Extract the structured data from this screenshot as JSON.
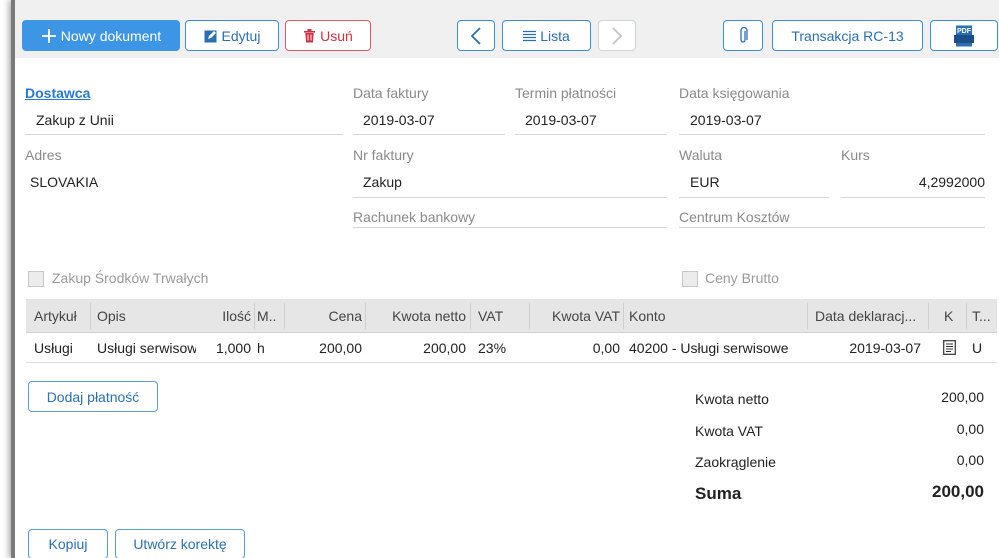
{
  "toolbar": {
    "new_doc": "Nowy dokument",
    "edit": "Edytuj",
    "delete": "Usuń",
    "list": "Lista",
    "transaction": "Transakcja RC-13",
    "pdf_label": "PDF"
  },
  "header": {
    "supplier_label": "Dostawca",
    "supplier_value": "Zakup z Unii",
    "invoice_date_label": "Data faktury",
    "invoice_date_value": "2019-03-07",
    "due_date_label": "Termin płatności",
    "due_date_value": "2019-03-07",
    "booking_date_label": "Data księgowania",
    "booking_date_value": "2019-03-07",
    "address_label": "Adres",
    "address_value": "SLOVAKIA",
    "invoice_no_label": "Nr faktury",
    "invoice_no_value": "Zakup",
    "currency_label": "Waluta",
    "currency_value": "EUR",
    "rate_label": "Kurs",
    "rate_value": "4,2992000",
    "bank_account_label": "Rachunek bankowy",
    "cost_center_label": "Centrum Kosztów"
  },
  "checkboxes": {
    "fixed_assets": "Zakup Środków Trwałych",
    "gross_prices": "Ceny Brutto"
  },
  "grid": {
    "columns": [
      "Artykuł",
      "Opis",
      "Ilość",
      "M..",
      "Cena",
      "Kwota netto",
      "VAT",
      "Kwota VAT",
      "Konto",
      "Data deklaracj...",
      "K",
      "T..."
    ],
    "rows": [
      [
        "Usługi",
        "Usługi serwisowe",
        "1,000",
        "h",
        "200,00",
        "200,00",
        "23%",
        "0,00",
        "40200 - Usługi serwisowe",
        "2019-03-07",
        "",
        "U"
      ]
    ]
  },
  "actions": {
    "add_payment": "Dodaj płatność",
    "copy": "Kopiuj",
    "create_correction": "Utwórz korektę"
  },
  "totals": {
    "net_label": "Kwota netto",
    "net_value": "200,00",
    "vat_label": "Kwota VAT",
    "vat_value": "0,00",
    "rounding_label": "Zaokrąglenie",
    "rounding_value": "0,00",
    "sum_label": "Suma",
    "sum_value": "200,00"
  },
  "colors": {
    "accent": "#3d95e6",
    "danger": "#d03040"
  }
}
